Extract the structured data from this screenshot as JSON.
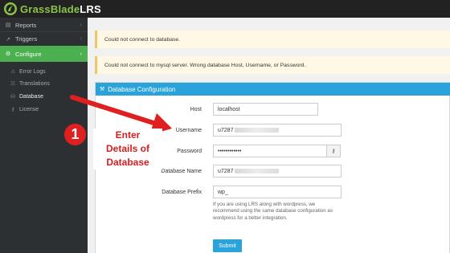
{
  "brand": {
    "name_main": "GrassBlade",
    "name_suffix": "LRS"
  },
  "sidebar": {
    "items": [
      {
        "label": "Reports",
        "icon": "bar-chart-icon"
      },
      {
        "label": "Triggers",
        "icon": "external-link-icon"
      },
      {
        "label": "Configure",
        "icon": "gear-icon"
      }
    ],
    "subitems": [
      {
        "label": "Error Logs",
        "icon": "warning-icon"
      },
      {
        "label": "Translations",
        "icon": "translate-icon"
      },
      {
        "label": "Database",
        "icon": "database-icon"
      },
      {
        "label": "License",
        "icon": "key-icon"
      }
    ]
  },
  "notices": [
    "Could not connect to database.",
    "Could not connect to mysql server. Wrong database Host, Username, or Password."
  ],
  "panel": {
    "title": "Database Configuration",
    "fields": {
      "host": {
        "label": "Host",
        "value": "localhost"
      },
      "username": {
        "label": "Username",
        "value": "u7287"
      },
      "password": {
        "label": "Password",
        "value": "••••••••••••"
      },
      "database_name": {
        "label": "Database Name",
        "value": "u7287"
      },
      "database_prefix": {
        "label": "Database Prefix",
        "value": "wp_"
      }
    },
    "help_lines": [
      "If you are using LRS along with wordpress, we",
      "recommend using the same database configuration as",
      "wordpress for a better integration."
    ],
    "submit_label": "Submit"
  },
  "annotation": {
    "step_number": "1",
    "lines": [
      "Enter",
      "Details of",
      "Database"
    ],
    "color": "#e02020"
  },
  "colors": {
    "accent": "#29a3d9",
    "configure": "#4caf50",
    "sidebar": "#2d3033",
    "notice_border": "#f0c36d"
  }
}
